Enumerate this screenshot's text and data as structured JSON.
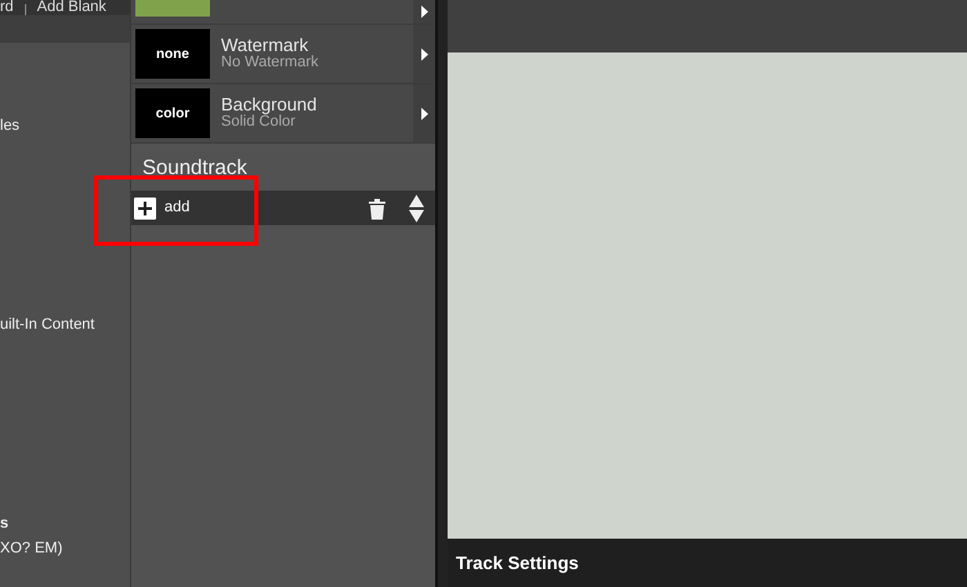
{
  "toolbar": {
    "items": [
      "rd",
      "Add Blank"
    ]
  },
  "left_panel": {
    "items": [
      {
        "label": "les",
        "bold": false
      },
      {
        "label": "uilt-In Content",
        "bold": false
      },
      {
        "label": "s",
        "bold": true
      },
      {
        "label": "XO? EM)",
        "bold": false
      }
    ]
  },
  "layers": [
    {
      "kind": "photo"
    },
    {
      "kind": "swatch",
      "thumb": "none",
      "title": "Watermark",
      "subtitle": "No Watermark"
    },
    {
      "kind": "swatch",
      "thumb": "color",
      "title": "Background",
      "subtitle": "Solid Color"
    }
  ],
  "soundtrack": {
    "title": "Soundtrack",
    "add_label": "add"
  },
  "track_settings": {
    "title": "Track Settings"
  },
  "highlight": true
}
